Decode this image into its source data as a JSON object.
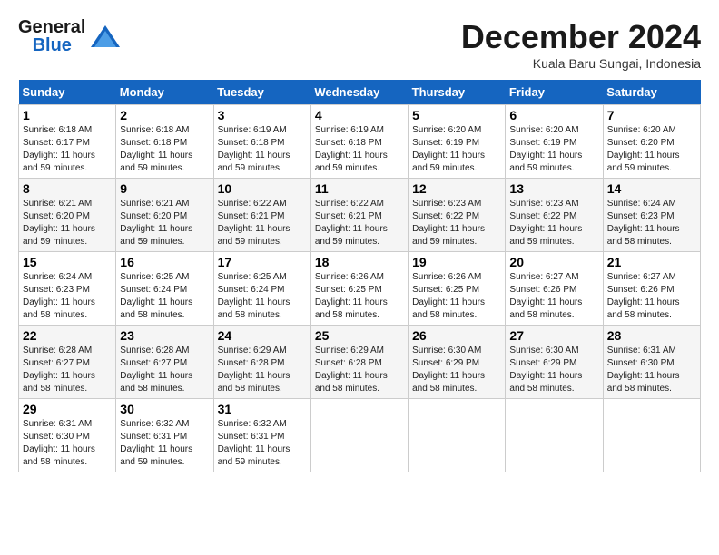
{
  "logo": {
    "line1": "General",
    "line2": "Blue"
  },
  "title": "December 2024",
  "subtitle": "Kuala Baru Sungai, Indonesia",
  "days_header": [
    "Sunday",
    "Monday",
    "Tuesday",
    "Wednesday",
    "Thursday",
    "Friday",
    "Saturday"
  ],
  "weeks": [
    [
      {
        "day": "1",
        "info": "Sunrise: 6:18 AM\nSunset: 6:17 PM\nDaylight: 11 hours\nand 59 minutes."
      },
      {
        "day": "2",
        "info": "Sunrise: 6:18 AM\nSunset: 6:18 PM\nDaylight: 11 hours\nand 59 minutes."
      },
      {
        "day": "3",
        "info": "Sunrise: 6:19 AM\nSunset: 6:18 PM\nDaylight: 11 hours\nand 59 minutes."
      },
      {
        "day": "4",
        "info": "Sunrise: 6:19 AM\nSunset: 6:18 PM\nDaylight: 11 hours\nand 59 minutes."
      },
      {
        "day": "5",
        "info": "Sunrise: 6:20 AM\nSunset: 6:19 PM\nDaylight: 11 hours\nand 59 minutes."
      },
      {
        "day": "6",
        "info": "Sunrise: 6:20 AM\nSunset: 6:19 PM\nDaylight: 11 hours\nand 59 minutes."
      },
      {
        "day": "7",
        "info": "Sunrise: 6:20 AM\nSunset: 6:20 PM\nDaylight: 11 hours\nand 59 minutes."
      }
    ],
    [
      {
        "day": "8",
        "info": "Sunrise: 6:21 AM\nSunset: 6:20 PM\nDaylight: 11 hours\nand 59 minutes."
      },
      {
        "day": "9",
        "info": "Sunrise: 6:21 AM\nSunset: 6:20 PM\nDaylight: 11 hours\nand 59 minutes."
      },
      {
        "day": "10",
        "info": "Sunrise: 6:22 AM\nSunset: 6:21 PM\nDaylight: 11 hours\nand 59 minutes."
      },
      {
        "day": "11",
        "info": "Sunrise: 6:22 AM\nSunset: 6:21 PM\nDaylight: 11 hours\nand 59 minutes."
      },
      {
        "day": "12",
        "info": "Sunrise: 6:23 AM\nSunset: 6:22 PM\nDaylight: 11 hours\nand 59 minutes."
      },
      {
        "day": "13",
        "info": "Sunrise: 6:23 AM\nSunset: 6:22 PM\nDaylight: 11 hours\nand 59 minutes."
      },
      {
        "day": "14",
        "info": "Sunrise: 6:24 AM\nSunset: 6:23 PM\nDaylight: 11 hours\nand 58 minutes."
      }
    ],
    [
      {
        "day": "15",
        "info": "Sunrise: 6:24 AM\nSunset: 6:23 PM\nDaylight: 11 hours\nand 58 minutes."
      },
      {
        "day": "16",
        "info": "Sunrise: 6:25 AM\nSunset: 6:24 PM\nDaylight: 11 hours\nand 58 minutes."
      },
      {
        "day": "17",
        "info": "Sunrise: 6:25 AM\nSunset: 6:24 PM\nDaylight: 11 hours\nand 58 minutes."
      },
      {
        "day": "18",
        "info": "Sunrise: 6:26 AM\nSunset: 6:25 PM\nDaylight: 11 hours\nand 58 minutes."
      },
      {
        "day": "19",
        "info": "Sunrise: 6:26 AM\nSunset: 6:25 PM\nDaylight: 11 hours\nand 58 minutes."
      },
      {
        "day": "20",
        "info": "Sunrise: 6:27 AM\nSunset: 6:26 PM\nDaylight: 11 hours\nand 58 minutes."
      },
      {
        "day": "21",
        "info": "Sunrise: 6:27 AM\nSunset: 6:26 PM\nDaylight: 11 hours\nand 58 minutes."
      }
    ],
    [
      {
        "day": "22",
        "info": "Sunrise: 6:28 AM\nSunset: 6:27 PM\nDaylight: 11 hours\nand 58 minutes."
      },
      {
        "day": "23",
        "info": "Sunrise: 6:28 AM\nSunset: 6:27 PM\nDaylight: 11 hours\nand 58 minutes."
      },
      {
        "day": "24",
        "info": "Sunrise: 6:29 AM\nSunset: 6:28 PM\nDaylight: 11 hours\nand 58 minutes."
      },
      {
        "day": "25",
        "info": "Sunrise: 6:29 AM\nSunset: 6:28 PM\nDaylight: 11 hours\nand 58 minutes."
      },
      {
        "day": "26",
        "info": "Sunrise: 6:30 AM\nSunset: 6:29 PM\nDaylight: 11 hours\nand 58 minutes."
      },
      {
        "day": "27",
        "info": "Sunrise: 6:30 AM\nSunset: 6:29 PM\nDaylight: 11 hours\nand 58 minutes."
      },
      {
        "day": "28",
        "info": "Sunrise: 6:31 AM\nSunset: 6:30 PM\nDaylight: 11 hours\nand 58 minutes."
      }
    ],
    [
      {
        "day": "29",
        "info": "Sunrise: 6:31 AM\nSunset: 6:30 PM\nDaylight: 11 hours\nand 58 minutes."
      },
      {
        "day": "30",
        "info": "Sunrise: 6:32 AM\nSunset: 6:31 PM\nDaylight: 11 hours\nand 59 minutes."
      },
      {
        "day": "31",
        "info": "Sunrise: 6:32 AM\nSunset: 6:31 PM\nDaylight: 11 hours\nand 59 minutes."
      },
      null,
      null,
      null,
      null
    ]
  ]
}
